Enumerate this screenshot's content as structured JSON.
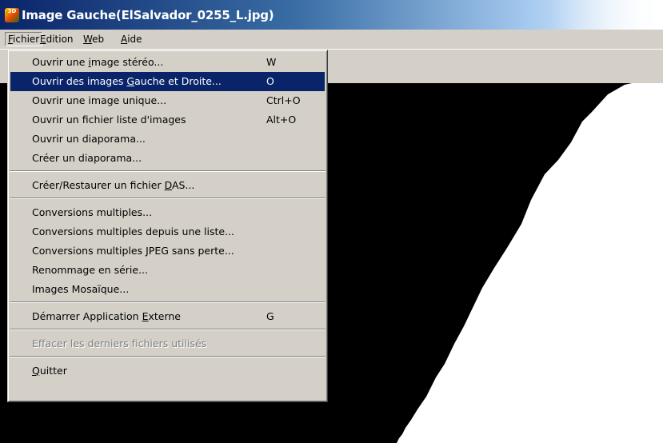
{
  "window": {
    "title": "Image Gauche(ElSalvador_0255_L.jpg)",
    "icon_text": "3D"
  },
  "menubar": [
    {
      "label": "Fichier",
      "mnemonic": "F"
    },
    {
      "label": "Edition",
      "mnemonic": "E"
    },
    {
      "label": "Web",
      "mnemonic": "W"
    },
    {
      "label": "Aide",
      "mnemonic": "A"
    }
  ],
  "menu": {
    "groups": [
      [
        {
          "pre": "Ouvrir une ",
          "key": "i",
          "post": "mage stéréo...",
          "shortcut": "W"
        },
        {
          "pre": "Ouvrir des images ",
          "key": "G",
          "post": "auche et Droite...",
          "shortcut": "O",
          "highlighted": true
        },
        {
          "pre": "Ouvrir une image unique...",
          "key": "",
          "post": "",
          "shortcut": "Ctrl+O"
        },
        {
          "pre": "Ouvrir un fichier liste d'images",
          "key": "",
          "post": "",
          "shortcut": "Alt+O"
        },
        {
          "pre": "Ouvrir un diaporama...",
          "key": "",
          "post": "",
          "shortcut": ""
        },
        {
          "pre": "Créer un diaporama...",
          "key": "",
          "post": "",
          "shortcut": ""
        }
      ],
      [
        {
          "pre": "Créer/Restaurer un fichier ",
          "key": "D",
          "post": "AS...",
          "shortcut": ""
        }
      ],
      [
        {
          "pre": "Conversions multiples...",
          "key": "",
          "post": "",
          "shortcut": ""
        },
        {
          "pre": "Conversions multiples depuis une liste...",
          "key": "",
          "post": "",
          "shortcut": ""
        },
        {
          "pre": "Conversions multiples JPEG sans perte...",
          "key": "",
          "post": "",
          "shortcut": ""
        },
        {
          "pre": "Renommage en série...",
          "key": "",
          "post": "",
          "shortcut": ""
        },
        {
          "pre": "Images Mosaïque...",
          "key": "",
          "post": "",
          "shortcut": ""
        }
      ],
      [
        {
          "pre": "Démarrer Application ",
          "key": "E",
          "post": "xterne",
          "shortcut": "G"
        }
      ],
      [
        {
          "pre": "Effacer les derniers fichiers utilisés",
          "key": "",
          "post": "",
          "shortcut": "",
          "disabled": true
        }
      ],
      [
        {
          "pre": "",
          "key": "Q",
          "post": "uitter",
          "shortcut": ""
        }
      ]
    ]
  },
  "colors": {
    "title_gradient_start": "#0a246a",
    "menu_background": "#d4d0c8",
    "highlight": "#0a246a",
    "image_area": "#000000"
  }
}
